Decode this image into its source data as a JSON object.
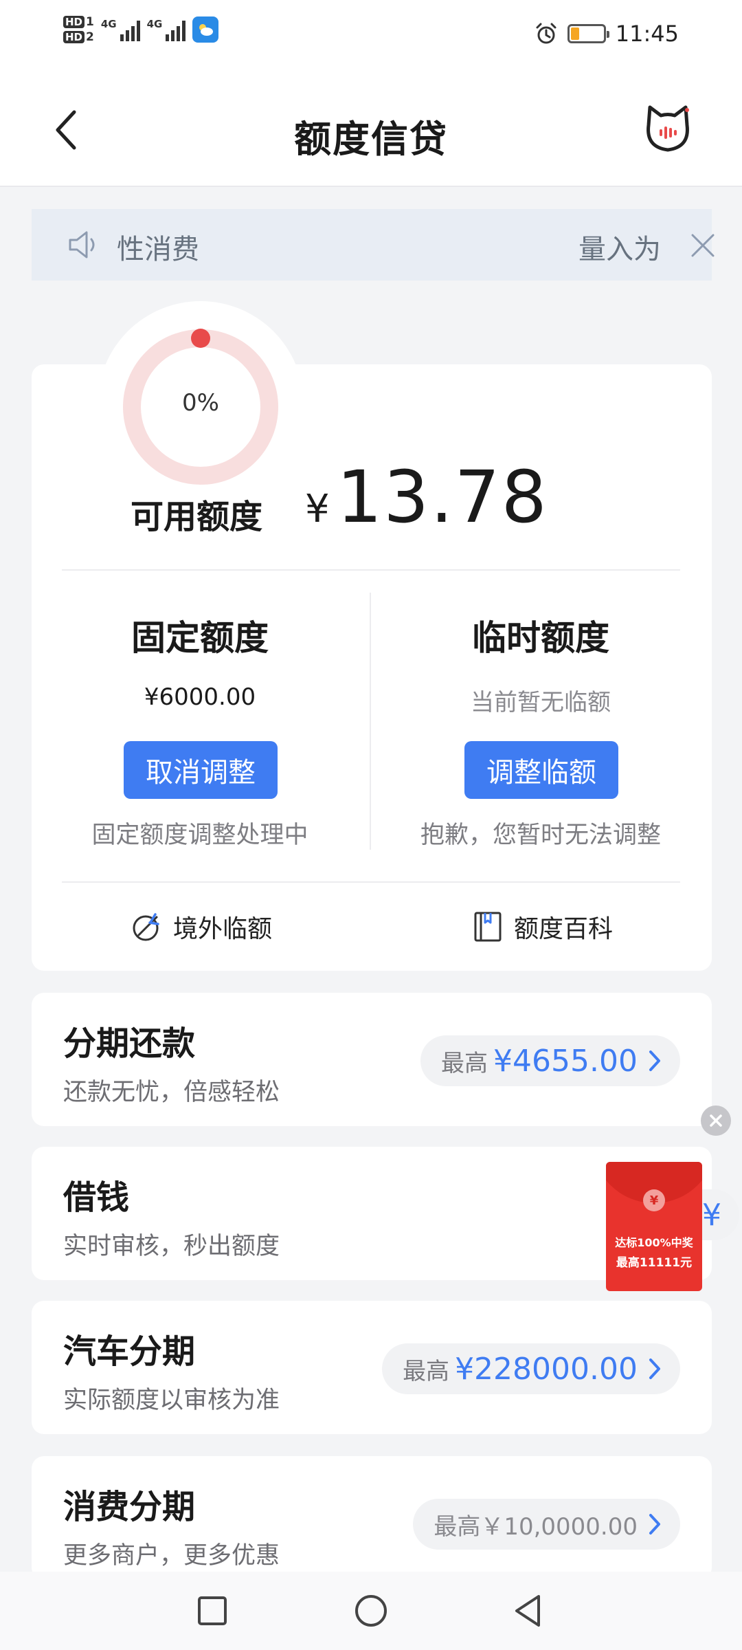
{
  "status_bar": {
    "sim1": "HD",
    "sim2": "HD",
    "net1": "4G",
    "net2": "4G",
    "time": "11:45"
  },
  "header": {
    "title": "额度信贷"
  },
  "notice": {
    "text_left": "性消费",
    "text_right": "量入为"
  },
  "credit": {
    "usage_percent": "0%",
    "usage_value": 0,
    "available_label": "可用额度",
    "currency": "¥",
    "available_amount": "13.78",
    "fixed": {
      "title": "固定额度",
      "amount": "¥6000.00",
      "button": "取消调整",
      "note": "固定额度调整处理中"
    },
    "temporary": {
      "title": "临时额度",
      "status": "当前暂无临额",
      "button": "调整临额",
      "note": "抱歉，您暂时无法调整"
    },
    "links": {
      "overseas": "境外临额",
      "wiki": "额度百科"
    }
  },
  "products": [
    {
      "name": "分期还款",
      "desc": "还款无忧，倍感轻松",
      "label": "最高",
      "value": "¥4655.00"
    },
    {
      "name": "借钱",
      "desc": "实时审核，秒出额度",
      "label": "最高",
      "value": "¥"
    },
    {
      "name": "汽车分期",
      "desc": "实际额度以审核为准",
      "label": "最高",
      "value": "¥228000.00"
    },
    {
      "name": "消费分期",
      "desc": "更多商户，更多优惠",
      "label": "",
      "value": "最高￥10,0000.00"
    }
  ],
  "red_packet": {
    "coin": "¥",
    "line1": "达标100%中奖",
    "line2": "最高11111元"
  },
  "colors": {
    "accent": "#3f7cf2",
    "ring": "#f8dede",
    "ring_dot": "#e84a4a",
    "red_packet": "#e8332d"
  },
  "icons": {
    "back": "chevron-left-icon",
    "mascot": "cat-mascot-icon",
    "speaker": "speaker-icon",
    "close": "close-icon",
    "overseas": "plane-globe-icon",
    "wiki": "book-icon"
  }
}
